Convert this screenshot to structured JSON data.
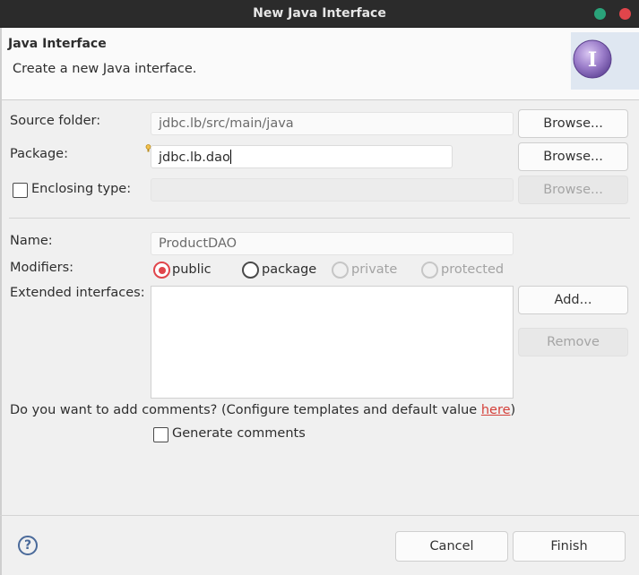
{
  "window": {
    "title": "New Java Interface"
  },
  "banner": {
    "heading": "Java Interface",
    "description": "Create a new Java interface."
  },
  "form": {
    "source_folder": {
      "label": "Source folder:",
      "value": "jdbc.lb/src/main/java",
      "button": "Browse..."
    },
    "package": {
      "label": "Package:",
      "value": "jdbc.lb.dao",
      "button": "Browse..."
    },
    "enclosing_type": {
      "label": "Enclosing type:",
      "value": "",
      "button": "Browse...",
      "checked": false
    },
    "name": {
      "label": "Name:",
      "value": "ProductDAO"
    },
    "modifiers": {
      "label": "Modifiers:",
      "options": [
        {
          "label": "public",
          "selected": true,
          "enabled": true
        },
        {
          "label": "package",
          "selected": false,
          "enabled": true
        },
        {
          "label": "private",
          "selected": false,
          "enabled": false
        },
        {
          "label": "protected",
          "selected": false,
          "enabled": false
        }
      ]
    },
    "extended_interfaces": {
      "label": "Extended interfaces:",
      "items": [],
      "add_button": "Add...",
      "remove_button": "Remove"
    },
    "comments": {
      "question_prefix": "Do you want to add comments? (Configure templates and default value ",
      "link": "here",
      "question_suffix": ")",
      "checkbox_label": "Generate comments",
      "checked": false
    }
  },
  "footer": {
    "help_icon": "?",
    "cancel": "Cancel",
    "finish": "Finish"
  },
  "colors": {
    "accent": "#e0454b",
    "titlebar": "#2b2b2b",
    "minimize": "#2aa37a"
  }
}
